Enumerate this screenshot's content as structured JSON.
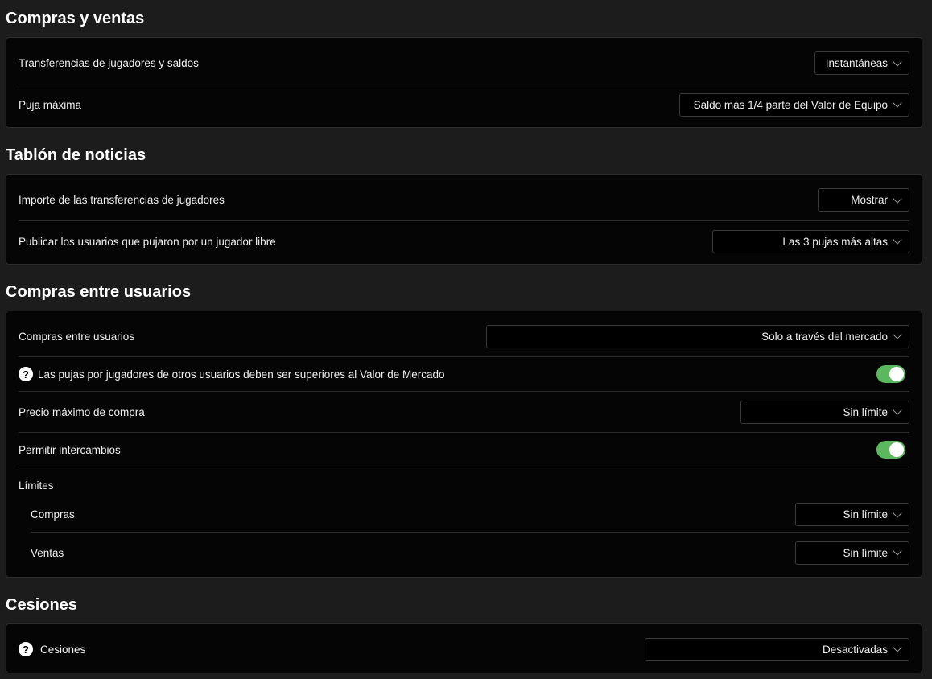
{
  "sections": {
    "compras_ventas": {
      "title": "Compras y ventas",
      "transferencias": {
        "label": "Transferencias de jugadores y saldos",
        "value": "Instantáneas"
      },
      "puja_maxima": {
        "label": "Puja máxima",
        "value": "Saldo más 1/4 parte del Valor de Equipo"
      }
    },
    "tablon": {
      "title": "Tablón de noticias",
      "importe": {
        "label": "Importe de las transferencias de jugadores",
        "value": "Mostrar"
      },
      "publicar": {
        "label": "Publicar los usuarios que pujaron por un jugador libre",
        "value": "Las 3 pujas más altas"
      }
    },
    "compras_usuarios": {
      "title": "Compras entre usuarios",
      "compras": {
        "label": "Compras entre usuarios",
        "value": "Solo a través del mercado"
      },
      "pujas_superiores": {
        "label": "Las pujas por jugadores de otros usuarios deben ser superiores al Valor de Mercado",
        "enabled": true
      },
      "precio_maximo": {
        "label": "Precio máximo de compra",
        "value": "Sin límite"
      },
      "intercambios": {
        "label": "Permitir intercambios",
        "enabled": true
      },
      "limites": {
        "label": "Límites",
        "compras": {
          "label": "Compras",
          "value": "Sin límite"
        },
        "ventas": {
          "label": "Ventas",
          "value": "Sin límite"
        }
      }
    },
    "cesiones": {
      "title": "Cesiones",
      "cesiones": {
        "label": "Cesiones",
        "value": "Desactivadas"
      }
    }
  },
  "icons": {
    "help": "?"
  },
  "colors": {
    "toggle_on": "#5cb85c",
    "background": "#1c1c1c",
    "card": "#050505"
  }
}
